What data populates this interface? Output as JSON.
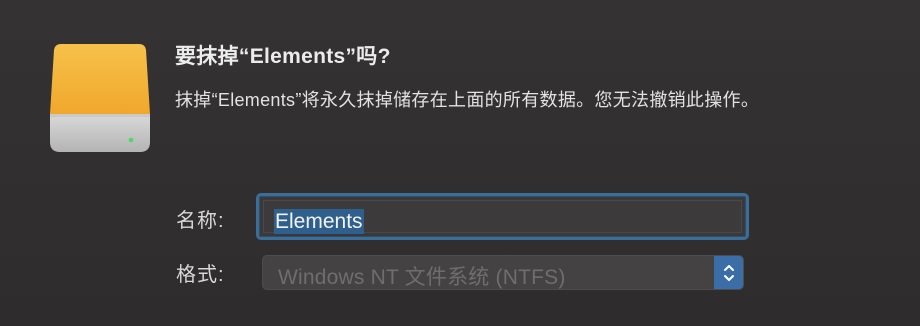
{
  "dialog": {
    "title": "要抹掉“Elements”吗?",
    "message": "抹掉“Elements”将永久抹掉储存在上面的所有数据。您无法撤销此操作。",
    "icon": "external-drive-icon"
  },
  "form": {
    "name_label": "名称:",
    "name_value": "Elements",
    "format_label": "格式:",
    "format_value": "Windows NT 文件系统 (NTFS)",
    "format_stepper_icon": "up-down-chevron-icon"
  },
  "colors": {
    "drive_top": "#f5b43a",
    "focus_ring": "#3b6d97",
    "stepper": "#3b6ea6",
    "selection": "#2f5f8c"
  }
}
